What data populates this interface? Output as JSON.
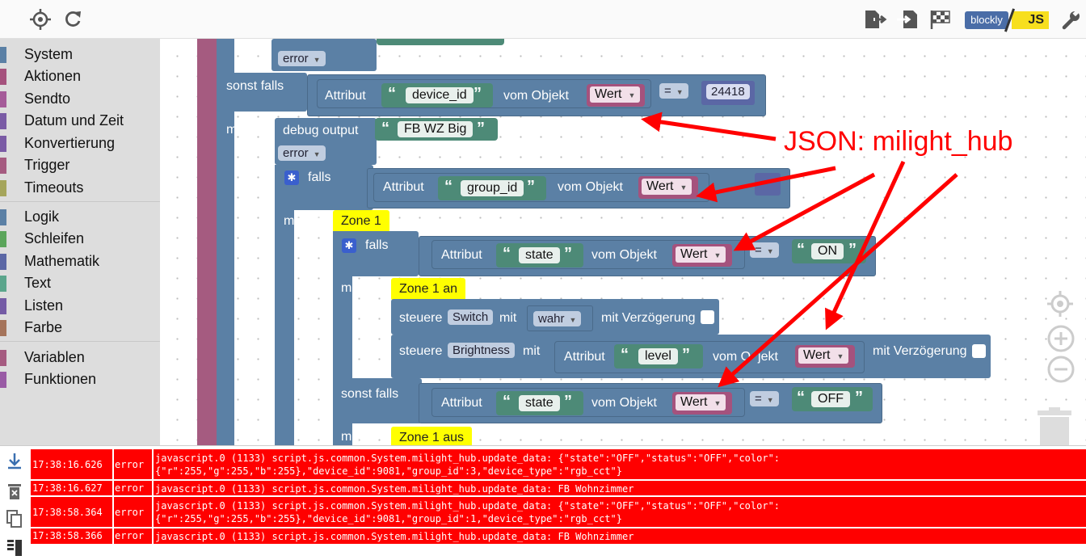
{
  "toolbar": {
    "blockly_label": "blockly",
    "js_label": "JS"
  },
  "toolbox": {
    "group1": [
      {
        "label": "System",
        "color": "#5b80a5"
      },
      {
        "label": "Aktionen",
        "color": "#a5527d"
      },
      {
        "label": "Sendto",
        "color": "#a55b99"
      },
      {
        "label": "Datum und Zeit",
        "color": "#7a5ba5"
      },
      {
        "label": "Konvertierung",
        "color": "#7a5ba5"
      },
      {
        "label": "Trigger",
        "color": "#a55b80"
      },
      {
        "label": "Timeouts",
        "color": "#a5a55b"
      }
    ],
    "group2": [
      {
        "label": "Logik",
        "color": "#5b80a5"
      },
      {
        "label": "Schleifen",
        "color": "#5ba55b"
      },
      {
        "label": "Mathematik",
        "color": "#5b67a5"
      },
      {
        "label": "Text",
        "color": "#5ba58c"
      },
      {
        "label": "Listen",
        "color": "#745ba5"
      },
      {
        "label": "Farbe",
        "color": "#a5745b"
      }
    ],
    "group3": [
      {
        "label": "Variablen",
        "color": "#a55b80"
      },
      {
        "label": "Funktionen",
        "color": "#995ba5"
      }
    ]
  },
  "blocks": {
    "error1": "error",
    "sonst_falls": "sonst falls",
    "attribut": "Attribut",
    "device_id": "device_id",
    "vom_objekt": "vom Objekt",
    "wert": "Wert",
    "eq": "=",
    "num_24418": "24418",
    "mache": "mache",
    "debug_output": "debug output",
    "fb_wz_big": "FB WZ Big",
    "error2": "error",
    "falls": "falls",
    "group_id": "group_id",
    "zone1": "Zone 1",
    "state": "state",
    "on": "ON",
    "zone1_an": "Zone 1 an",
    "steuere": "steuere",
    "switch": "Switch",
    "mit": "mit",
    "wahr": "wahr",
    "mit_verzoegerung": "mit Verzögerung",
    "brightness": "Brightness",
    "level": "level",
    "vom_objekt_partial": "vom O",
    "vom_objekt_partial2": "jekt",
    "off": "OFF",
    "zone1_aus": "Zone 1 aus"
  },
  "annotation": "JSON: milight_hub",
  "log": [
    {
      "time": "17:38:16.626",
      "level": "error",
      "message": "javascript.0 (1133) script.js.common.System.milight_hub.update_data: {\"state\":\"OFF\",\"status\":\"OFF\",\"color\":\n{\"r\":255,\"g\":255,\"b\":255},\"device_id\":9081,\"group_id\":3,\"device_type\":\"rgb_cct\"}"
    },
    {
      "time": "17:38:16.627",
      "level": "error",
      "message": "javascript.0 (1133) script.js.common.System.milight_hub.update_data: FB Wohnzimmer"
    },
    {
      "time": "17:38:58.364",
      "level": "error",
      "message": "javascript.0 (1133) script.js.common.System.milight_hub.update_data: {\"state\":\"OFF\",\"status\":\"OFF\",\"color\":\n{\"r\":255,\"g\":255,\"b\":255},\"device_id\":9081,\"group_id\":1,\"device_type\":\"rgb_cct\"}"
    },
    {
      "time": "17:38:58.366",
      "level": "error",
      "message": "javascript.0 (1133) script.js.common.System.milight_hub.update_data: FB Wohnzimmer"
    }
  ]
}
